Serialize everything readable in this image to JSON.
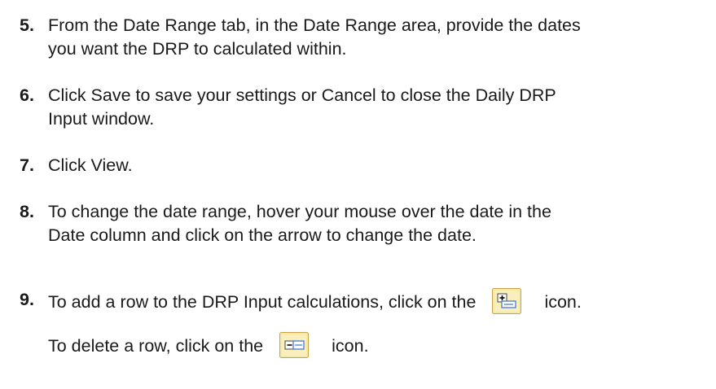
{
  "steps": [
    {
      "number": "5.",
      "lines": [
        "From the Date Range tab, in the Date Range area, provide the dates",
        "you want the DRP to calculated within."
      ]
    },
    {
      "number": "6.",
      "lines": [
        "Click Save to save your settings or Cancel to close the Daily DRP",
        "Input window."
      ]
    },
    {
      "number": "7.",
      "lines": [
        "Click View."
      ]
    },
    {
      "number": "8.",
      "lines": [
        "To change the date range, hover your mouse over the date in the",
        "Date column and click on the arrow to change the date."
      ]
    },
    {
      "number": "9.",
      "add_text_before": "To add a row to the DRP Input calculations, click on the",
      "add_text_after": "icon.",
      "add_icon": "add-row-icon",
      "delete_text_before": "To delete a row, click on the",
      "delete_text_after": "icon.",
      "delete_icon": "delete-row-icon"
    }
  ],
  "colors": {
    "text": "#1a1a1a",
    "icon_face": "#f4e9a8",
    "icon_border": "#c9a24a",
    "icon_plus_box": "#ffffff",
    "icon_blue": "#3d6fd1"
  }
}
